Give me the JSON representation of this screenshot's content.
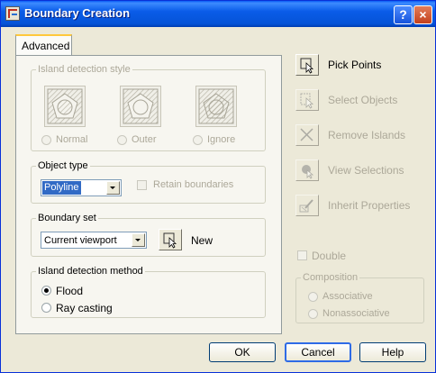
{
  "window": {
    "title": "Boundary Creation",
    "help_glyph": "?",
    "close_glyph": "×",
    "icon": "boundary-app-icon"
  },
  "tabs": [
    {
      "label": "Advanced",
      "active": true
    }
  ],
  "island_style": {
    "title": "Island detection style",
    "options": [
      {
        "label": "Normal",
        "icon": "island-normal-icon"
      },
      {
        "label": "Outer",
        "icon": "island-outer-icon"
      },
      {
        "label": "Ignore",
        "icon": "island-ignore-icon"
      }
    ]
  },
  "object_type": {
    "title": "Object type",
    "value": "Polyline",
    "retain_label": "Retain boundaries"
  },
  "boundary_set": {
    "title": "Boundary set",
    "value": "Current viewport",
    "new_label": "New"
  },
  "island_method": {
    "title": "Island detection method",
    "options": [
      {
        "label": "Flood",
        "selected": true
      },
      {
        "label": "Ray casting",
        "selected": false
      }
    ]
  },
  "side_actions": [
    {
      "label": "Pick Points",
      "enabled": true,
      "icon": "pick-points-icon"
    },
    {
      "label": "Select Objects",
      "enabled": false,
      "icon": "select-objects-icon"
    },
    {
      "label": "Remove Islands",
      "enabled": false,
      "icon": "remove-islands-icon"
    },
    {
      "label": "View Selections",
      "enabled": false,
      "icon": "view-selections-icon"
    },
    {
      "label": "Inherit Properties",
      "enabled": false,
      "icon": "inherit-properties-icon"
    }
  ],
  "double_label": "Double",
  "composition": {
    "title": "Composition",
    "options": [
      {
        "label": "Associative"
      },
      {
        "label": "Nonassociative"
      }
    ]
  },
  "buttons": {
    "ok": "OK",
    "cancel": "Cancel",
    "help": "Help"
  },
  "colors": {
    "titlebar": "#0a5ce8",
    "dialog_bg": "#ece9d8",
    "selection": "#316ac5",
    "disabled_text": "#aca899"
  }
}
